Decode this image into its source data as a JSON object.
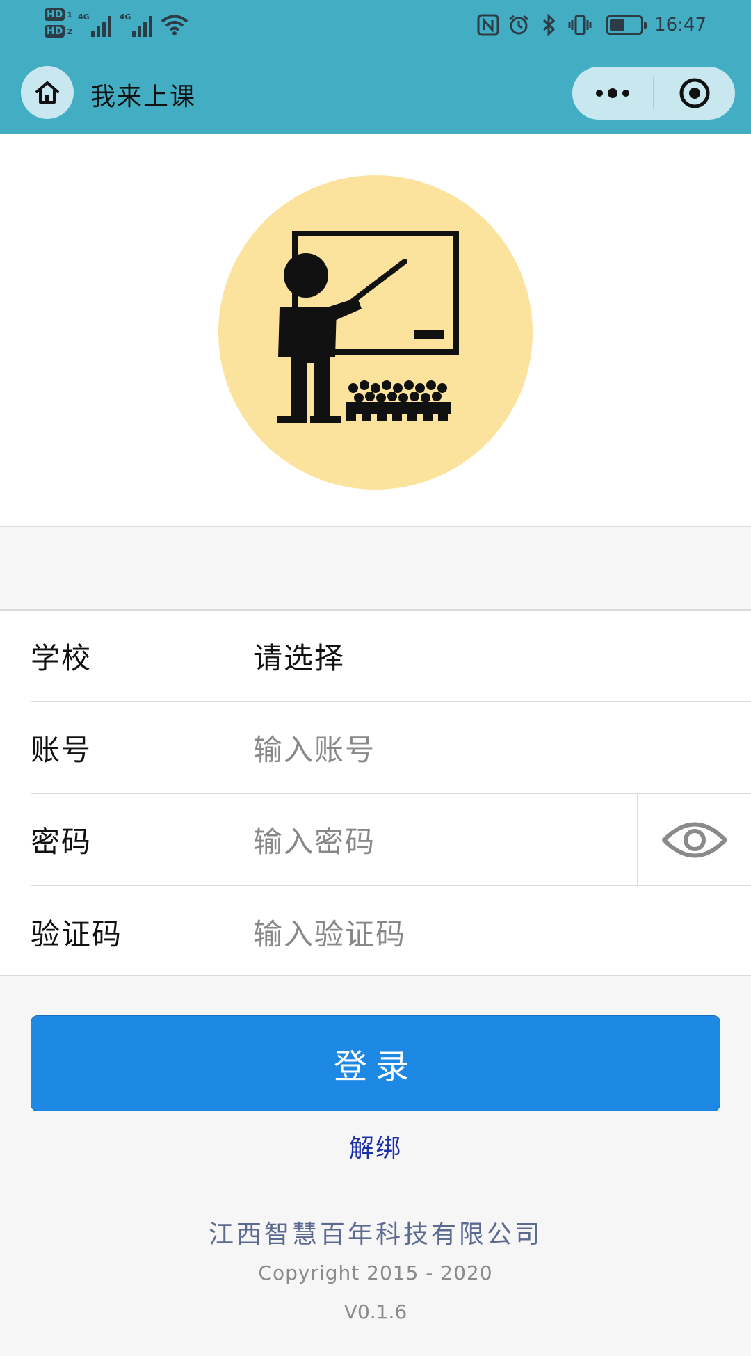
{
  "status_bar": {
    "sim1": "HD",
    "sim1_num": "1",
    "sim2": "HD",
    "sim2_num": "2",
    "network1": "4G",
    "network2": "4G",
    "battery_level": 0.5,
    "time": "16:47",
    "icons": [
      "nfc-icon",
      "alarm-icon",
      "bluetooth-icon",
      "vibrate-icon",
      "battery-icon"
    ]
  },
  "nav": {
    "title": "我来上课",
    "home_icon": "home-icon",
    "more_icon": "more-dots-icon",
    "close_icon": "target-close-icon"
  },
  "logo": {
    "icon": "teacher-classroom-illustration",
    "bg_color": "#fbe39d"
  },
  "form": {
    "school": {
      "label": "学校",
      "value": "请选择"
    },
    "account": {
      "label": "账号",
      "placeholder": "输入账号"
    },
    "password": {
      "label": "密码",
      "placeholder": "输入密码",
      "toggle_icon": "eye-icon"
    },
    "captcha": {
      "label": "验证码",
      "placeholder": "输入验证码"
    }
  },
  "actions": {
    "login_label": "登录",
    "unbind_label": "解绑"
  },
  "footer": {
    "company": "江西智慧百年科技有限公司",
    "copyright": "Copyright 2015 - 2020",
    "version": "V0.1.6"
  },
  "colors": {
    "header_bg": "#43adc4",
    "primary_button": "#1e88e5",
    "link": "#1b2fa8"
  }
}
